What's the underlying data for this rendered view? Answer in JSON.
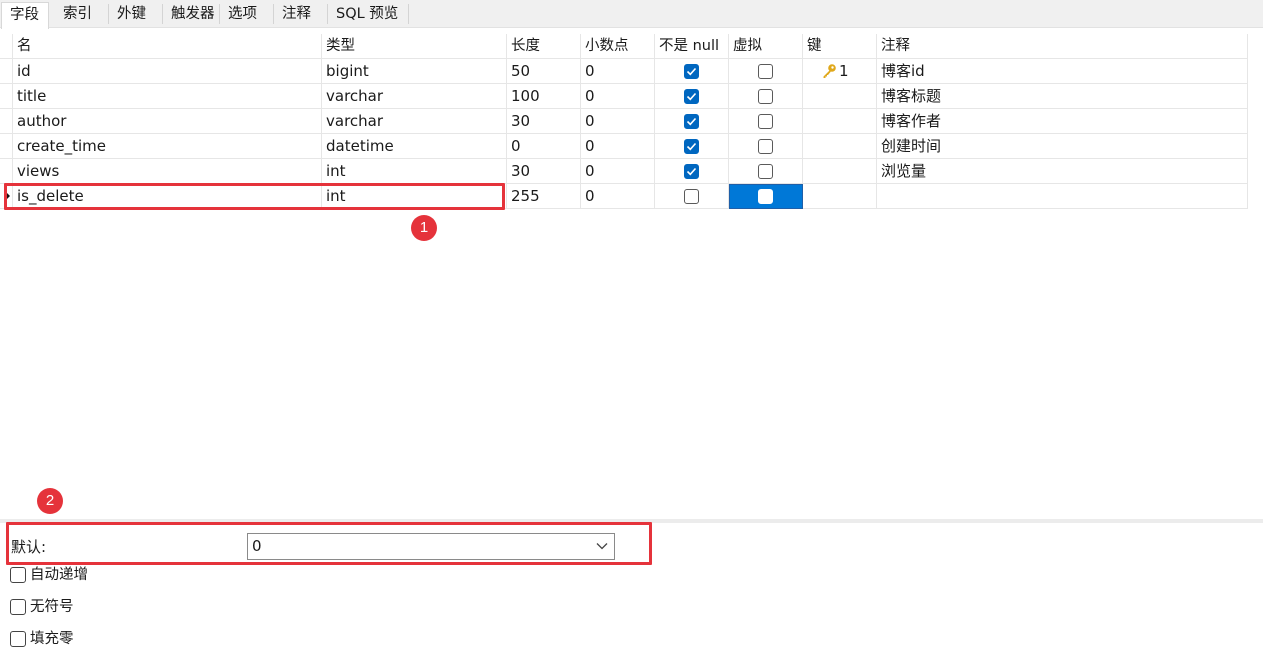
{
  "tabs": [
    {
      "label": "字段"
    },
    {
      "label": "索引"
    },
    {
      "label": "外键"
    },
    {
      "label": "触发器"
    },
    {
      "label": "选项"
    },
    {
      "label": "注释"
    },
    {
      "label": "SQL 预览"
    }
  ],
  "columns": [
    "名",
    "类型",
    "长度",
    "小数点",
    "不是 null",
    "虚拟",
    "键",
    "注释"
  ],
  "rows": [
    {
      "name": "id",
      "type": "bigint",
      "length": "50",
      "decimals": "0",
      "not_null": true,
      "virtual": false,
      "key": "1",
      "comment": "博客id"
    },
    {
      "name": "title",
      "type": "varchar",
      "length": "100",
      "decimals": "0",
      "not_null": true,
      "virtual": false,
      "key": "",
      "comment": "博客标题"
    },
    {
      "name": "author",
      "type": "varchar",
      "length": "30",
      "decimals": "0",
      "not_null": true,
      "virtual": false,
      "key": "",
      "comment": "博客作者"
    },
    {
      "name": "create_time",
      "type": "datetime",
      "length": "0",
      "decimals": "0",
      "not_null": true,
      "virtual": false,
      "key": "",
      "comment": "创建时间"
    },
    {
      "name": "views",
      "type": "int",
      "length": "30",
      "decimals": "0",
      "not_null": true,
      "virtual": false,
      "key": "",
      "comment": "浏览量"
    },
    {
      "name": "is_delete",
      "type": "int",
      "length": "255",
      "decimals": "0",
      "not_null": false,
      "virtual": false,
      "key": "",
      "comment": ""
    }
  ],
  "annotations": {
    "badge1": "1",
    "badge2": "2"
  },
  "properties": {
    "default_label": "默认:",
    "default_value": "0",
    "options": [
      {
        "label": "自动递增",
        "checked": false
      },
      {
        "label": "无符号",
        "checked": false
      },
      {
        "label": "填充零",
        "checked": false
      }
    ]
  },
  "colors": {
    "accent": "#0067c0",
    "selection": "#0078d7",
    "highlight": "#e5333b",
    "key_icon": "#e0a81b"
  }
}
